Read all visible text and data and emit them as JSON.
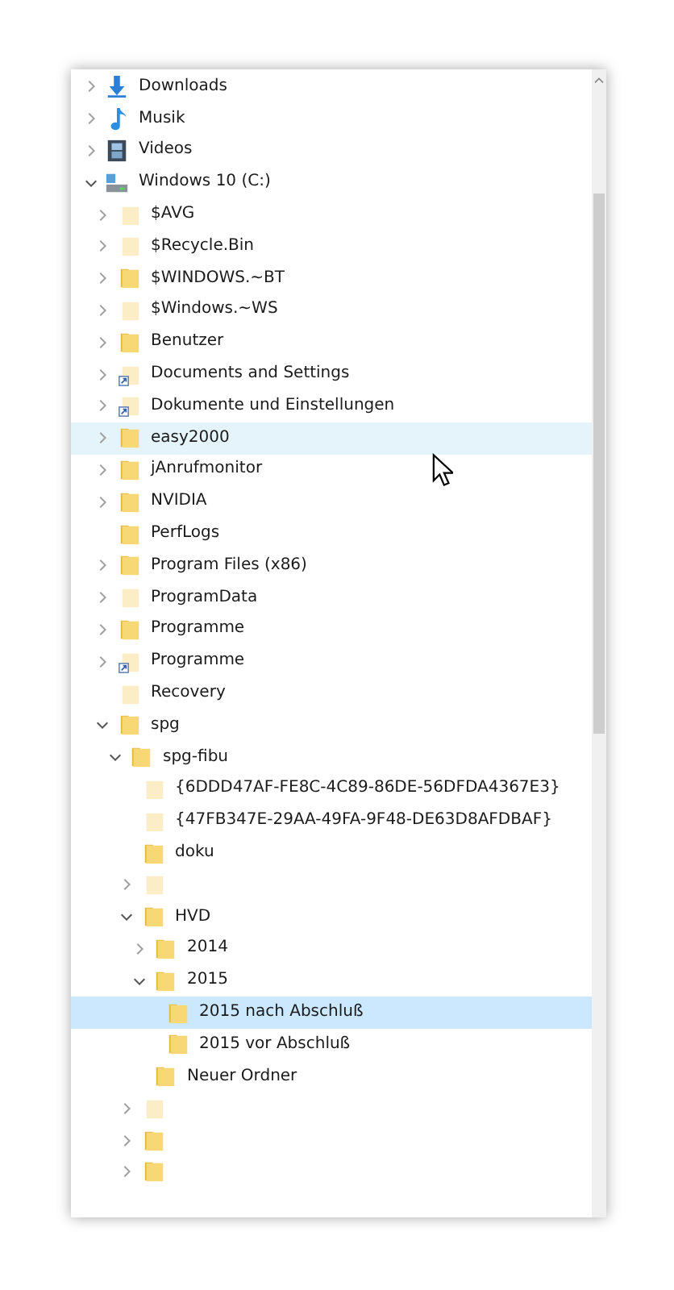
{
  "tree": [
    {
      "kind": "downloads",
      "label": "Downloads",
      "expanded": false,
      "selected": false,
      "hovered": false
    },
    {
      "kind": "music",
      "label": "Musik",
      "expanded": false,
      "selected": false,
      "hovered": false
    },
    {
      "kind": "videos",
      "label": "Videos",
      "expanded": false,
      "selected": false,
      "hovered": false
    },
    {
      "kind": "drive",
      "label": "Windows 10 (C:)",
      "expanded": true,
      "selected": false,
      "hovered": false,
      "children": [
        {
          "kind": "folder-hidden",
          "label": "$AVG",
          "expanded": false,
          "selected": false,
          "hovered": false
        },
        {
          "kind": "folder-hidden",
          "label": "$Recycle.Bin",
          "expanded": false,
          "selected": false,
          "hovered": false
        },
        {
          "kind": "folder",
          "label": "$WINDOWS.~BT",
          "expanded": false,
          "selected": false,
          "hovered": false
        },
        {
          "kind": "folder-hidden",
          "label": "$Windows.~WS",
          "expanded": false,
          "selected": false,
          "hovered": false
        },
        {
          "kind": "folder",
          "label": "Benutzer",
          "expanded": false,
          "selected": false,
          "hovered": false
        },
        {
          "kind": "shortcut",
          "label": "Documents and Settings",
          "expanded": false,
          "selected": false,
          "hovered": false
        },
        {
          "kind": "shortcut",
          "label": "Dokumente und Einstellungen",
          "expanded": false,
          "selected": false,
          "hovered": false
        },
        {
          "kind": "folder",
          "label": "easy2000",
          "expanded": false,
          "selected": false,
          "hovered": true
        },
        {
          "kind": "folder",
          "label": "jAnrufmonitor",
          "expanded": false,
          "selected": false,
          "hovered": false
        },
        {
          "kind": "folder",
          "label": "NVIDIA",
          "expanded": false,
          "selected": false,
          "hovered": false
        },
        {
          "kind": "folder",
          "label": "PerfLogs",
          "selected": false,
          "hovered": false
        },
        {
          "kind": "folder",
          "label": "Program Files (x86)",
          "expanded": false,
          "selected": false,
          "hovered": false
        },
        {
          "kind": "folder-hidden",
          "label": "ProgramData",
          "expanded": false,
          "selected": false,
          "hovered": false
        },
        {
          "kind": "folder",
          "label": "Programme",
          "expanded": false,
          "selected": false,
          "hovered": false
        },
        {
          "kind": "shortcut",
          "label": "Programme",
          "expanded": false,
          "selected": false,
          "hovered": false
        },
        {
          "kind": "folder-hidden",
          "label": "Recovery",
          "selected": false,
          "hovered": false
        },
        {
          "kind": "folder",
          "label": "spg",
          "expanded": true,
          "selected": false,
          "hovered": false,
          "children": [
            {
              "kind": "folder",
              "label": "spg-fibu",
              "expanded": true,
              "selected": false,
              "hovered": false,
              "children": [
                {
                  "kind": "folder-hidden",
                  "label": "{6DDD47AF-FE8C-4C89-86DE-56DFDA4367E3}",
                  "selected": false,
                  "hovered": false
                },
                {
                  "kind": "folder-hidden",
                  "label": "{47FB347E-29AA-49FA-9F48-DE63D8AFDBAF}",
                  "selected": false,
                  "hovered": false
                },
                {
                  "kind": "folder",
                  "label": "doku",
                  "selected": false,
                  "hovered": false
                },
                {
                  "kind": "folder-hidden",
                  "expanded": false,
                  "selected": false,
                  "hovered": false
                },
                {
                  "kind": "folder",
                  "label": "HVD",
                  "expanded": true,
                  "selected": false,
                  "hovered": false,
                  "children": [
                    {
                      "kind": "folder",
                      "label": "2014",
                      "expanded": false,
                      "selected": false,
                      "hovered": false
                    },
                    {
                      "kind": "folder",
                      "label": "2015",
                      "expanded": true,
                      "selected": false,
                      "hovered": false,
                      "children": [
                        {
                          "kind": "folder",
                          "label": "2015 nach Abschluß",
                          "selected": true,
                          "hovered": false
                        },
                        {
                          "kind": "folder",
                          "label": "2015 vor Abschluß",
                          "selected": false,
                          "hovered": false
                        }
                      ]
                    },
                    {
                      "kind": "folder",
                      "label": "Neuer Ordner",
                      "selected": false,
                      "hovered": false
                    }
                  ]
                },
                {
                  "kind": "folder-hidden",
                  "expanded": false,
                  "selected": false,
                  "hovered": false
                },
                {
                  "kind": "folder",
                  "expanded": false,
                  "selected": false,
                  "hovered": false
                },
                {
                  "kind": "folder",
                  "expanded": false,
                  "selected": false,
                  "hovered": false
                }
              ]
            }
          ]
        }
      ]
    }
  ]
}
